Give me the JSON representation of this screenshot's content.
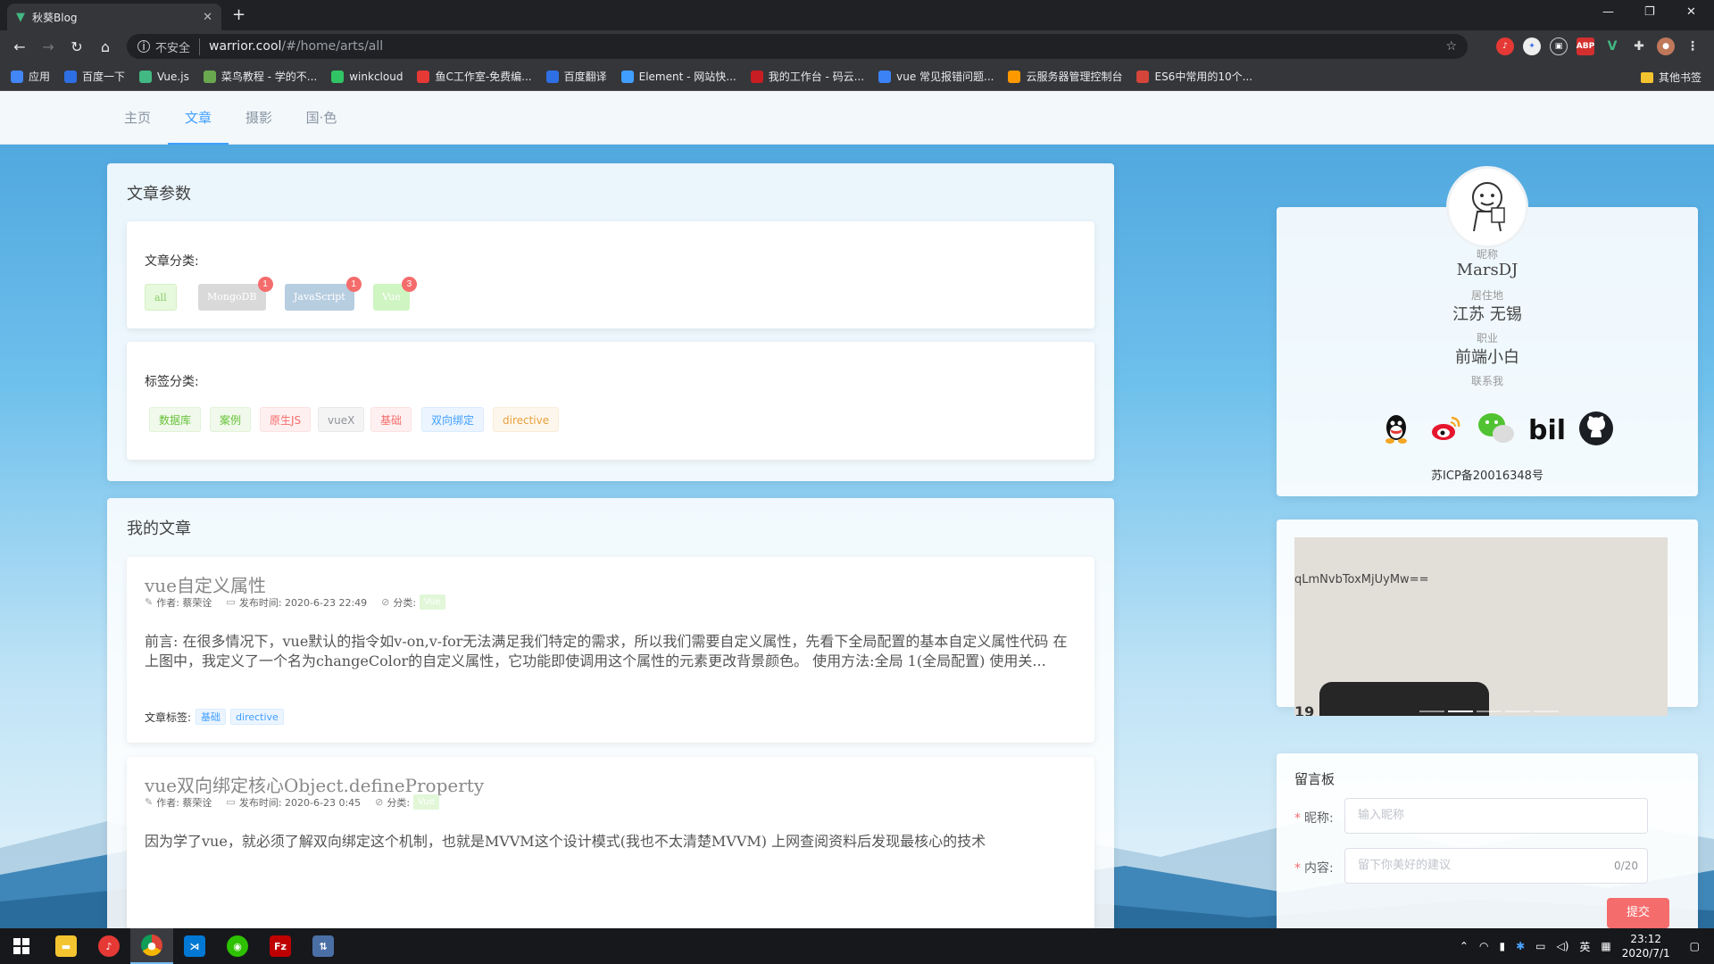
{
  "browser": {
    "tab_title": "秋葵Blog",
    "insecure_label": "不安全",
    "url_host": "warrior.cool",
    "url_path": "/#/home/arts/all"
  },
  "bookmarks": {
    "items": [
      {
        "label": "应用",
        "color": "#4285f4"
      },
      {
        "label": "百度一下",
        "color": "#2f6fe4"
      },
      {
        "label": "Vue.js",
        "color": "#42b883"
      },
      {
        "label": "菜鸟教程 - 学的不...",
        "color": "#6aa84f"
      },
      {
        "label": "winkcloud",
        "color": "#30c464"
      },
      {
        "label": "鱼C工作室-免费编...",
        "color": "#e53935"
      },
      {
        "label": "百度翻译",
        "color": "#2f6fe4"
      },
      {
        "label": "Element - 网站快...",
        "color": "#409eff"
      },
      {
        "label": "我的工作台 - 码云...",
        "color": "#c71d23"
      },
      {
        "label": "vue 常见报错问题...",
        "color": "#3b82f6"
      },
      {
        "label": "云服务器管理控制台",
        "color": "#ff9900"
      },
      {
        "label": "ES6中常用的10个...",
        "color": "#d4453a"
      }
    ],
    "other_label": "其他书签"
  },
  "site_nav": {
    "items": [
      "主页",
      "文章",
      "摄影",
      "国·色"
    ],
    "active": "文章"
  },
  "params_panel": {
    "title": "文章参数",
    "category_label": "文章分类:",
    "categories": [
      {
        "label": "all",
        "count": ""
      },
      {
        "label": "MongoDB",
        "count": "1"
      },
      {
        "label": "JavaScript",
        "count": "1"
      },
      {
        "label": "Vue",
        "count": "3"
      }
    ],
    "tag_label": "标签分类:",
    "tags": [
      "数据库",
      "案例",
      "原生JS",
      "vueX",
      "基础",
      "双向绑定",
      "directive"
    ]
  },
  "articles_panel": {
    "title": "我的文章",
    "articles": [
      {
        "title": "vue自定义属性",
        "author": "作者: 蔡荣诠",
        "date": "发布时间: 2020-6-23 22:49",
        "category_label": "分类:",
        "category": "Vue",
        "excerpt": "前言: 在很多情况下，vue默认的指令如v-on,v-for无法满足我们特定的需求，所以我们需要自定义属性，先看下全局配置的基本自定义属性代码 在上图中，我定义了一个名为changeColor的自定义属性，它功能即使调用这个属性的元素更改背景颜色。 使用方法:全局 1(全局配置) 使用关...",
        "tags_label": "文章标签:",
        "tags": [
          "基础",
          "directive"
        ]
      },
      {
        "title": "vue双向绑定核心Object.defineProperty",
        "author": "作者: 蔡荣诠",
        "date": "发布时间: 2020-6-23 0:45",
        "category_label": "分类:",
        "category": "Vue",
        "excerpt": "因为学了vue，就必须了解双向绑定这个机制，也就是MVVM这个设计模式(我也不太清楚MVVM) 上网查阅资料后发现最核心的技术"
      }
    ]
  },
  "profile": {
    "nickname_label": "昵称",
    "nickname": "MarsDJ",
    "location_label": "居住地",
    "location": "江苏 无锡",
    "job_label": "职业",
    "job": "前端小白",
    "contact_label": "联系我",
    "icp": "苏ICP备20016348号"
  },
  "carousel": {
    "caption": "qLmNvbToxMjUyMw=="
  },
  "guestbook": {
    "title": "留言板",
    "name_label": "昵称:",
    "name_placeholder": "输入昵称",
    "content_label": "内容:",
    "content_placeholder": "留下你美好的建议",
    "counter": "0/20",
    "submit_label": "提交"
  },
  "taskbar": {
    "time": "23:12",
    "date": "2020/7/1",
    "ime": "英"
  }
}
